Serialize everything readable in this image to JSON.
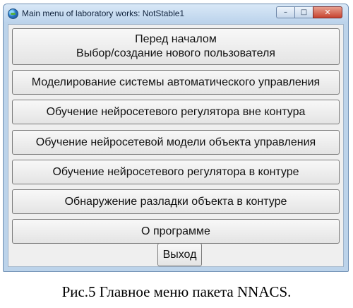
{
  "window": {
    "title": "Main menu of laboratory works: NotStable1",
    "controls": {
      "minimize": "–",
      "maximize": "□",
      "close": "✕"
    }
  },
  "menu": {
    "before_start_line1": "Перед началом",
    "before_start_line2": "Выбор/создание нового пользователя",
    "items": [
      "Моделирование системы автоматического управления",
      "Обучение нейросетевого регулятора вне контура",
      "Обучение нейросетевой модели объекта управления",
      "Обучение нейросетевого регулятора в контуре",
      "Обнаружение разладки объекта в контуре",
      "О программе"
    ],
    "exit": "Выход"
  },
  "caption": "Рис.5 Главное меню пакета NNACS."
}
